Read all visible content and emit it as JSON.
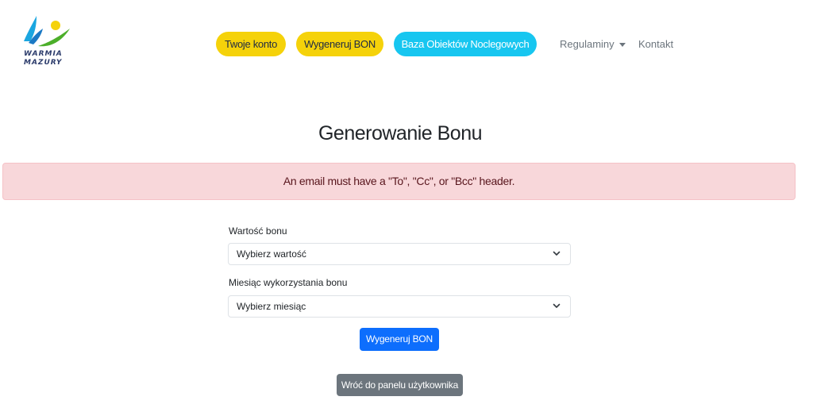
{
  "logo": {
    "line1": "WARMIA",
    "line2": "MAZURY"
  },
  "nav": {
    "account": "Twoje konto",
    "generate": "Wygeneruj BON",
    "base": "Baza Obiektów Noclegowych",
    "regulations": "Regulaminy",
    "contact": "Kontakt"
  },
  "page": {
    "title": "Generowanie Bonu"
  },
  "alert": {
    "message": "An email must have a \"To\", \"Cc\", or \"Bcc\" header."
  },
  "form": {
    "value_label": "Wartość bonu",
    "value_selected": "Wybierz wartość",
    "month_label": "Miesiąc wykorzystania bonu",
    "month_selected": "Wybierz miesiąc",
    "submit": "Wygeneruj BON",
    "back": "Wróć do panelu użytkownika"
  },
  "colors": {
    "nav_yellow": "#f5d20a",
    "nav_cyan": "#17c6f0",
    "alert_bg": "#f8d7da",
    "primary": "#0d6efd",
    "secondary": "#6c757d"
  }
}
